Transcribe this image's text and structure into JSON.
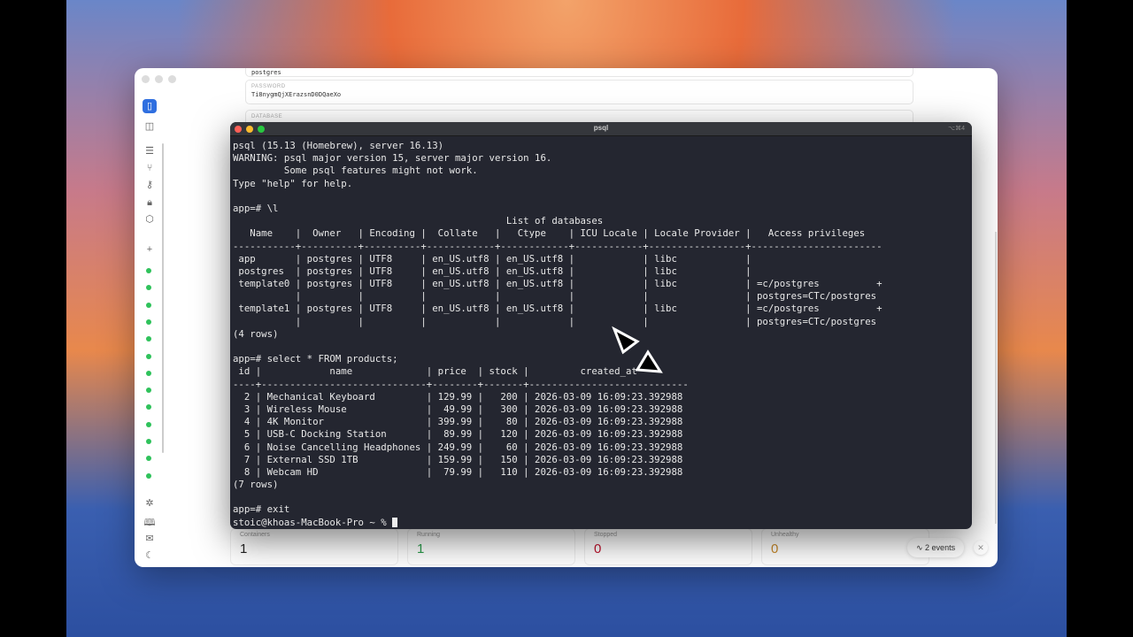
{
  "app": {
    "form": {
      "user_value": "postgres",
      "password_label": "PASSWORD",
      "password_value": "Ti8nygmQjXErazsnD0DQaeXo",
      "database_label": "DATABASE"
    },
    "sidebar": {
      "status_dots": 13,
      "status_color": "#2fc25b",
      "icons": [
        "app-logo",
        "sidebar-toggle",
        "containers",
        "git-branch",
        "key",
        "lock",
        "shield",
        "add",
        "sparkle",
        "book",
        "mail",
        "moon"
      ]
    },
    "stats": [
      {
        "label": "Containers",
        "value": "1",
        "color": "#222222"
      },
      {
        "label": "Running",
        "value": "1",
        "color": "#2a9d4b"
      },
      {
        "label": "Stopped",
        "value": "0",
        "color": "#c0122c"
      },
      {
        "label": "Unhealthy",
        "value": "0",
        "color": "#c98a2a"
      }
    ],
    "events_label": "2 events"
  },
  "terminal": {
    "title": "psql",
    "shortcut": "⌥⌘4",
    "lines": [
      "psql (15.13 (Homebrew), server 16.13)",
      "WARNING: psql major version 15, server major version 16.",
      "         Some psql features might not work.",
      "Type \"help\" for help.",
      "",
      "app=# \\l",
      "                                                List of databases",
      "   Name    |  Owner   | Encoding |  Collate   |   Ctype    | ICU Locale | Locale Provider |   Access privileges   ",
      "-----------+----------+----------+------------+------------+------------+-----------------+-----------------------",
      " app       | postgres | UTF8     | en_US.utf8 | en_US.utf8 |            | libc            | ",
      " postgres  | postgres | UTF8     | en_US.utf8 | en_US.utf8 |            | libc            | ",
      " template0 | postgres | UTF8     | en_US.utf8 | en_US.utf8 |            | libc            | =c/postgres          +",
      "           |          |          |            |            |            |                 | postgres=CTc/postgres",
      " template1 | postgres | UTF8     | en_US.utf8 | en_US.utf8 |            | libc            | =c/postgres          +",
      "           |          |          |            |            |            |                 | postgres=CTc/postgres",
      "(4 rows)",
      "",
      "app=# select * FROM products;",
      " id |            name             | price  | stock |         created_at         ",
      "----+-----------------------------+--------+-------+----------------------------",
      "  2 | Mechanical Keyboard         | 129.99 |   200 | 2026-03-09 16:09:23.392988",
      "  3 | Wireless Mouse              |  49.99 |   300 | 2026-03-09 16:09:23.392988",
      "  4 | 4K Monitor                  | 399.99 |    80 | 2026-03-09 16:09:23.392988",
      "  5 | USB-C Docking Station       |  89.99 |   120 | 2026-03-09 16:09:23.392988",
      "  6 | Noise Cancelling Headphones | 249.99 |    60 | 2026-03-09 16:09:23.392988",
      "  7 | External SSD 1TB            | 159.99 |   150 | 2026-03-09 16:09:23.392988",
      "  8 | Webcam HD                   |  79.99 |   110 | 2026-03-09 16:09:23.392988",
      "(7 rows)",
      "",
      "app=# exit"
    ],
    "prompt": "stoic@khoas-MacBook-Pro ~ % "
  }
}
